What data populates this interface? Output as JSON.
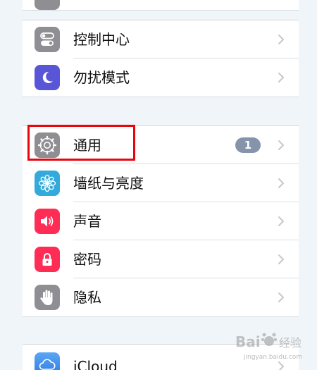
{
  "settings": {
    "group1": {
      "control_center": {
        "label": "控制中心",
        "icon": "control-center-icon",
        "color": "#8e8e93"
      },
      "do_not_disturb": {
        "label": "勿扰模式",
        "icon": "moon-icon",
        "color": "#5856d6"
      }
    },
    "group2": {
      "general": {
        "label": "通用",
        "icon": "gear-icon",
        "color": "#8e8e93",
        "badge": "1"
      },
      "wallpaper": {
        "label": "墙纸与亮度",
        "icon": "flower-icon",
        "color": "#34aadc"
      },
      "sounds": {
        "label": "声音",
        "icon": "speaker-icon",
        "color": "#ff2d55"
      },
      "passcode": {
        "label": "密码",
        "icon": "lock-icon",
        "color": "#ff2d55"
      },
      "privacy": {
        "label": "隐私",
        "icon": "hand-icon",
        "color": "#8e8e93"
      }
    },
    "group3": {
      "icloud": {
        "label": "iCloud",
        "icon": "cloud-icon",
        "color": "#3b8ee8"
      }
    }
  },
  "annotation": {
    "color": "#e8060c"
  },
  "watermark": {
    "line1": "Bai",
    "line2": "经验",
    "line3": "jingyan.baidu.com"
  }
}
